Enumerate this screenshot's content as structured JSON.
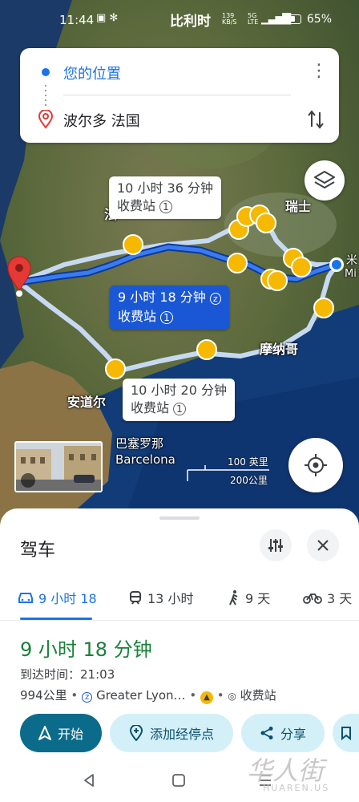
{
  "status_bar": {
    "time": "11:44",
    "center_text": "比利时",
    "speed": "139",
    "speed_unit": "KB/S",
    "network": "5G",
    "network_sub": "LTE",
    "battery": "65%"
  },
  "search": {
    "origin": "您的位置",
    "destination": "波尔多 法国"
  },
  "map": {
    "routes": [
      {
        "line1": "10 小时 36 分钟",
        "line2": "收费站"
      },
      {
        "line1": "9 小时 18 分钟",
        "line2": "收费站"
      },
      {
        "line1": "10 小时 20 分钟",
        "line2": "收费站"
      }
    ],
    "places": {
      "switzerland": "瑞士",
      "monaco": "摩纳哥",
      "andorra": "安道尔",
      "barcelona_cn": "巴塞罗那",
      "barcelona_en": "Barcelona",
      "milan_cn": "米",
      "milan_en": "Mi",
      "fragment": "法"
    },
    "scale": {
      "top": "100 英里",
      "bottom": "200公里"
    },
    "colors": {
      "route_selected": "#1a57d4",
      "route_alt": "#c7d9f2",
      "warning": "#f6b800"
    }
  },
  "sheet": {
    "title": "驾车",
    "modes": [
      {
        "label": "9 小时 18",
        "icon": "car-icon"
      },
      {
        "label": "13 小时",
        "icon": "train-icon"
      },
      {
        "label": "9 天",
        "icon": "walk-icon"
      },
      {
        "label": "3 天",
        "icon": "bike-icon"
      }
    ],
    "duration": "9 小时 18 分钟",
    "arrival_label": "到达时间：",
    "arrival_time": "21:03",
    "distance": "994公里",
    "via": "Greater Lyon…",
    "toll": "收费站",
    "actions": {
      "start": "开始",
      "add_stop": "添加经停点",
      "share": "分享"
    }
  },
  "watermark": {
    "main": "华人街",
    "sub": "HUAREN.US"
  }
}
